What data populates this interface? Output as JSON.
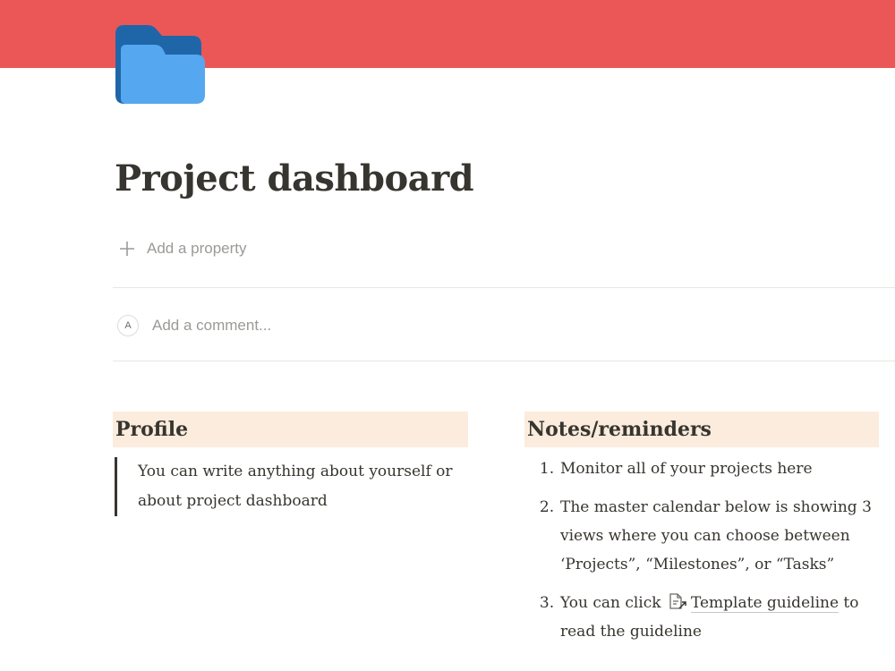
{
  "page": {
    "title": "Project dashboard",
    "cover_color": "#eb5757",
    "page_icon": "folder-icon"
  },
  "properties": {
    "add_property_label": "Add a property"
  },
  "comments": {
    "avatar_initial": "A",
    "placeholder": "Add a comment..."
  },
  "profile": {
    "heading": "Profile",
    "quote": "You can write anything about yourself or about project dashboard"
  },
  "notes": {
    "heading": "Notes/reminders",
    "items": [
      {
        "number": "1.",
        "text": "Monitor all of your projects here"
      },
      {
        "number": "2.",
        "text": "The master calendar below is showing 3 views where you can choose between ‘Projects”, “Milestones”, or “Tasks”"
      },
      {
        "number": "3.",
        "text_before": "You can click",
        "link_label": "Template guideline",
        "text_after": "to read the guideline"
      }
    ]
  },
  "colors": {
    "heading_background": "#fbecdd",
    "folder_front": "#55a8f0",
    "folder_back": "#1f66a8",
    "text": "#37352f",
    "muted_text": "#9b9a97"
  }
}
